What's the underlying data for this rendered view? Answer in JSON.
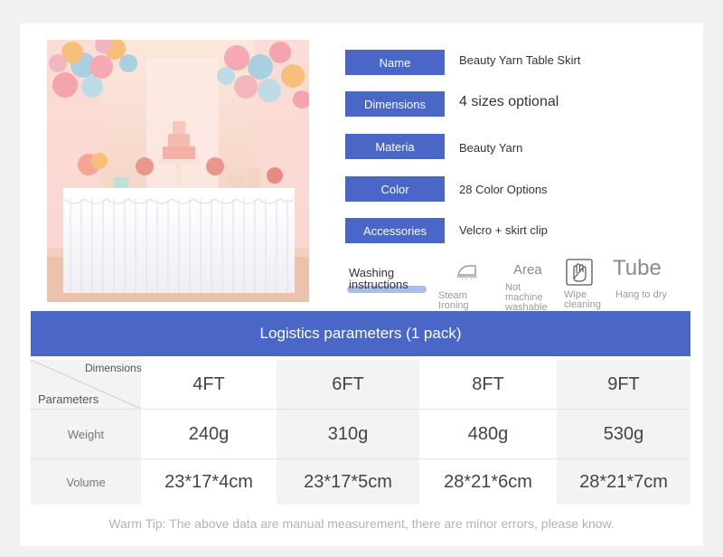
{
  "specs": [
    {
      "label": "Name",
      "value": "Beauty Yarn Table Skirt"
    },
    {
      "label": "Dimensions",
      "value": "4 sizes optional"
    },
    {
      "label": "Materia",
      "value": "Beauty Yarn"
    },
    {
      "label": "Color",
      "value": "28 Color Options"
    },
    {
      "label": "Accessories",
      "value": "Velcro + skirt clip"
    }
  ],
  "care": {
    "title_line1": "Washing",
    "title_line2": "instructions",
    "items": [
      {
        "icon": "iron-icon",
        "line1": "Steam",
        "line2": "Ironing",
        "line3": ""
      },
      {
        "icon": "area-text",
        "heading": "Area",
        "line1": "Not",
        "line2": "machine",
        "line3": "washable"
      },
      {
        "icon": "hand-wipe-icon",
        "line1": "Wipe",
        "line2": "cleaning",
        "line3": ""
      },
      {
        "icon": "tube-text",
        "heading": "Tube",
        "line1": "Hang to dry",
        "line2": "",
        "line3": ""
      }
    ]
  },
  "logistics": {
    "title": "Logistics parameters (1 pack)",
    "corner_top": "Dimensions",
    "corner_bottom": "Parameters",
    "sizes": [
      "4FT",
      "6FT",
      "8FT",
      "9FT"
    ],
    "rows": [
      {
        "label": "Weight",
        "values": [
          "240g",
          "310g",
          "480g",
          "530g"
        ]
      },
      {
        "label": "Volume",
        "values": [
          "23*17*4cm",
          "23*17*5cm",
          "28*21*6cm",
          "28*21*7cm"
        ]
      }
    ]
  },
  "tip": "Warm Tip: The above data are manual measurement, there are minor errors, please know.",
  "colors": {
    "accent": "#4a67c8",
    "shade": "#f3f3f3",
    "tip_text": "#b3b3b3"
  }
}
